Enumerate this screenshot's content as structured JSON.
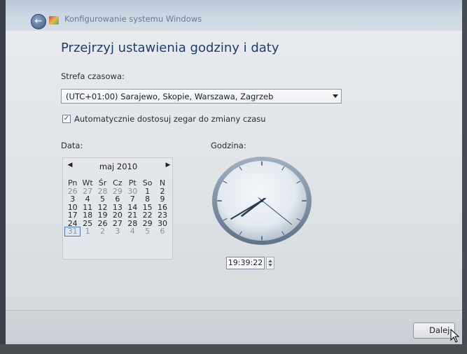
{
  "window": {
    "title": "Konfigurowanie systemu Windows"
  },
  "page": {
    "heading": "Przejrzyj ustawienia godziny i daty"
  },
  "timezone": {
    "label": "Strefa czasowa:",
    "value": "(UTC+01:00) Sarajewo, Skopie, Warszawa, Zagrzeb"
  },
  "dst": {
    "checked": true,
    "label": "Automatycznie dostosuj zegar do zmiany czasu"
  },
  "date": {
    "label": "Data:",
    "month": "maj 2010",
    "weekdays": [
      "Pn",
      "Wt",
      "Śr",
      "Cz",
      "Pt",
      "So",
      "N"
    ],
    "weeks": [
      [
        "26",
        "27",
        "28",
        "29",
        "30",
        "1",
        "2"
      ],
      [
        "3",
        "4",
        "5",
        "6",
        "7",
        "8",
        "9"
      ],
      [
        "10",
        "11",
        "12",
        "13",
        "14",
        "15",
        "16"
      ],
      [
        "17",
        "18",
        "19",
        "20",
        "21",
        "22",
        "23"
      ],
      [
        "24",
        "25",
        "26",
        "27",
        "28",
        "29",
        "30"
      ],
      [
        "31",
        "1",
        "2",
        "3",
        "4",
        "5",
        "6"
      ]
    ],
    "selected": "31"
  },
  "time": {
    "label": "Godzina:",
    "value": "19:39:22"
  },
  "buttons": {
    "next": "Dalej"
  }
}
